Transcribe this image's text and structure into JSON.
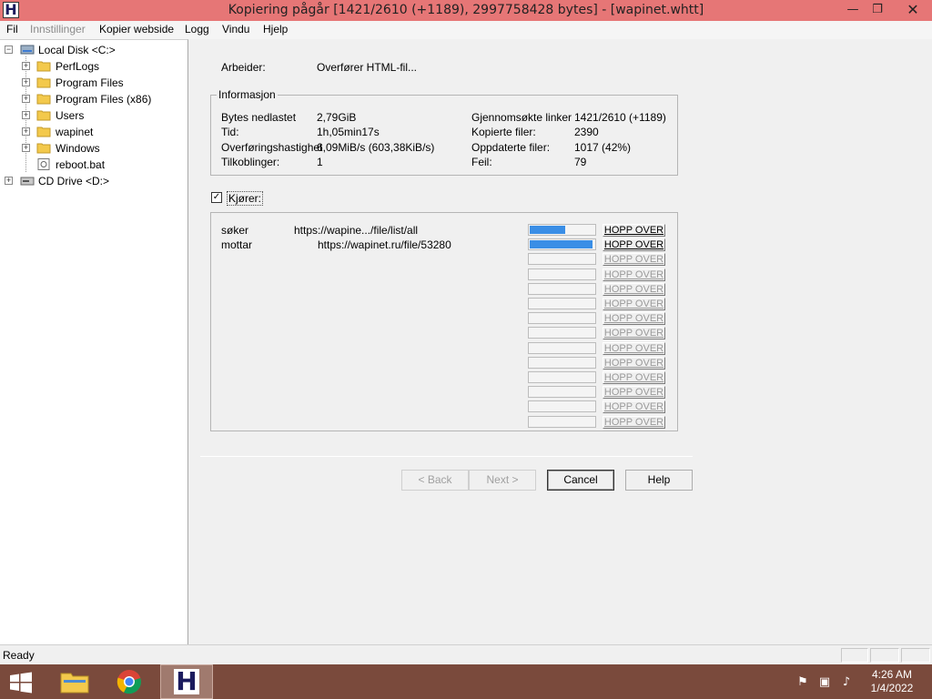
{
  "window": {
    "title": "Kopiering pågår [1421/2610 (+1189), 2997758428 bytes] - [wapinet.whtt]",
    "minimize_glyph": "—",
    "maximize_glyph": "❐",
    "close_glyph": "✕"
  },
  "menu": {
    "items": [
      "Fil",
      "Innstillinger",
      "Kopier webside",
      "Logg",
      "Vindu",
      "Hjelp"
    ]
  },
  "tree": {
    "root_label": "Local Disk <C:>",
    "children": [
      "PerfLogs",
      "Program Files",
      "Program Files (x86)",
      "Users",
      "wapinet",
      "Windows",
      "reboot.bat"
    ],
    "cd_label": "CD Drive <D:>"
  },
  "main": {
    "worker_label": "Arbeider:",
    "worker_value": "Overfører HTML-fil...",
    "info_title": "Informasjon",
    "info": {
      "bytes_label": "Bytes nedlastet",
      "bytes_value": "2,79GiB",
      "time_label": "Tid:",
      "time_value": "1h,05min17s",
      "speed_label": "Overføringshastighet",
      "speed_value": "6,09MiB/s (603,38KiB/s)",
      "conn_label": "Tilkoblinger:",
      "conn_value": "1",
      "links_label": "Gjennomsøkte linker",
      "links_value": "1421/2610 (+1189)",
      "copied_label": "Kopierte filer:",
      "copied_value": "2390",
      "updated_label": "Oppdaterte filer:",
      "updated_value": "1017 (42%)",
      "errors_label": "Feil:",
      "errors_value": "79"
    },
    "running_label": "Kjører:",
    "running_checked": "✓",
    "transfers": [
      {
        "action": "søker",
        "url": "https://wapine.../file/list/all",
        "progress": 0.55
      },
      {
        "action": "mottar",
        "url": "https://wapinet.ru/file/53280",
        "progress": 0.97
      }
    ],
    "skip_label": "HOPP OVER",
    "buttons": {
      "back": "< Back",
      "next": "Next >",
      "cancel": "Cancel",
      "help": "Help"
    }
  },
  "status": {
    "text": "Ready"
  },
  "taskbar": {
    "hts_glyph": "H",
    "time": "4:26 AM",
    "date": "1/4/2022"
  },
  "colors": {
    "titlebar": "#e67676",
    "progress_fill": "#3a8ee6",
    "taskbar": "#7a4a3c"
  }
}
